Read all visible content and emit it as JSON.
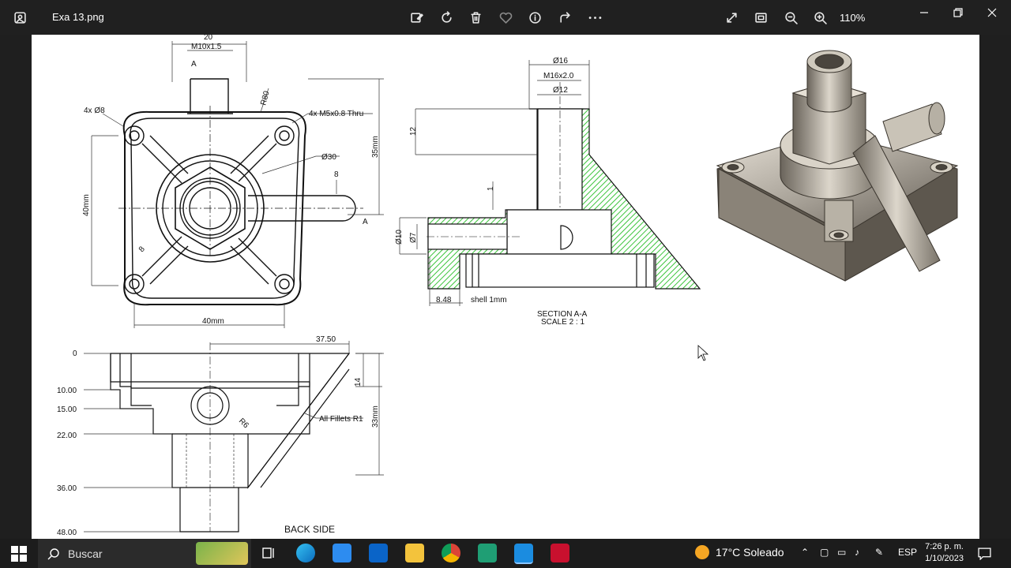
{
  "window": {
    "title": "Exa 13.png",
    "zoom": "110%"
  },
  "drawing": {
    "front": {
      "dim_20": "20",
      "thread_top": "M10x1.5",
      "section_a": "A",
      "holes": "4x Ø8",
      "r80": "R80",
      "thru": "4x M5x0.8 Thru",
      "d30": "Ø30",
      "dim_8": "8",
      "dim_35": "35mm",
      "dim_40v": "40mm",
      "dim_40h": "40mm",
      "r8": "8"
    },
    "section": {
      "d16": "Ø16",
      "thread": "M16x2.0",
      "d12": "Ø12",
      "dim_12": "12",
      "dim_1": "1",
      "d10": "Ø10",
      "d7": "Ø7",
      "dim_848": "8.48",
      "shell": "shell 1mm",
      "caption1": "SECTION A-A",
      "caption2": "SCALE 2 : 1"
    },
    "back": {
      "dim_3750": "37.50",
      "y0": "0",
      "y10": "10.00",
      "y15": "15.00",
      "y22": "22.00",
      "y36": "36.00",
      "y48": "48.00",
      "dim_14": "14",
      "dim_33": "33mm",
      "r6": "R6",
      "fillets": "All Fillets R1",
      "caption": "BACK SIDE"
    }
  },
  "taskbar": {
    "search_placeholder": "Buscar",
    "weather": "17°C  Soleado",
    "lang": "ESP",
    "time": "7:26 p. m.",
    "date": "1/10/2023"
  },
  "colors": {
    "hatch": "#3cc43c",
    "accent": "#0078d4"
  }
}
